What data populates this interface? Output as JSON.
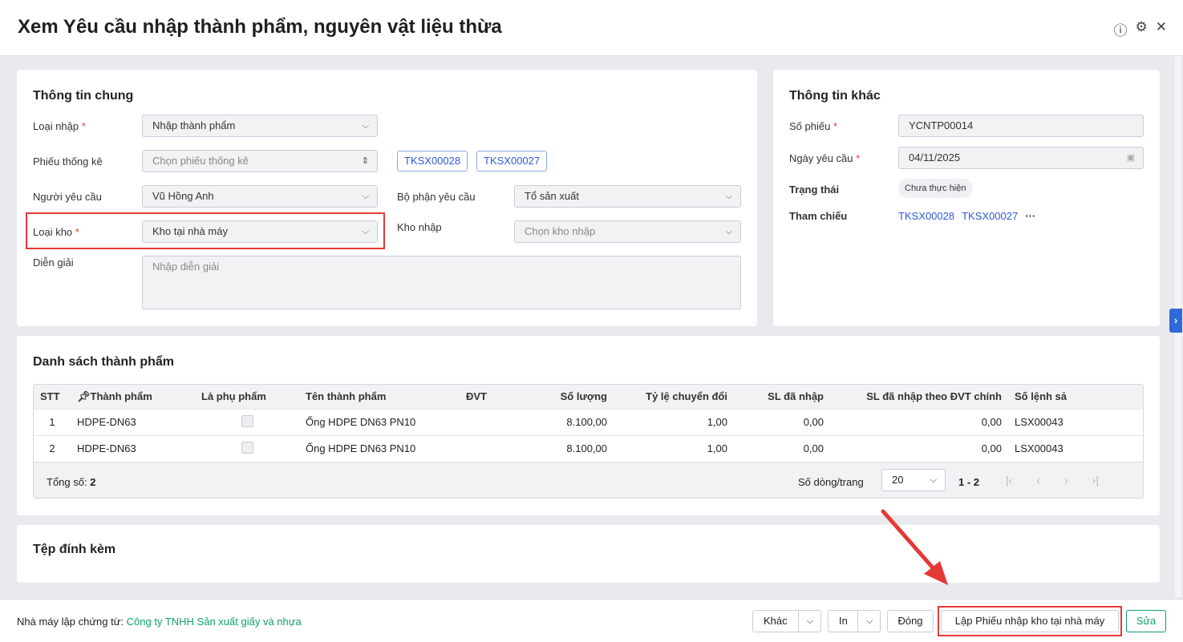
{
  "title": "Xem Yêu cầu nhập thành phẩm, nguyên vật liệu thừa",
  "header_icons": [
    "help-icon",
    "gear-icon",
    "close-icon"
  ],
  "general": {
    "title": "Thông tin chung",
    "loai_nhap_label": "Loại nhập",
    "loai_nhap_value": "Nhập thành phẩm",
    "phieu_tk_label": "Phiếu thống kê",
    "phieu_tk_placeholder": "Chọn phiếu thống kê",
    "tags": [
      "TKSX00028",
      "TKSX00027"
    ],
    "nguoi_yc_label": "Người yêu cầu",
    "nguoi_yc_value": "Vũ Hồng Anh",
    "bo_phan_label": "Bộ phận yêu cầu",
    "bo_phan_value": "Tổ sản xuất",
    "loai_kho_label": "Loại kho",
    "loai_kho_value": "Kho tại nhà máy",
    "kho_nhap_label": "Kho nhập",
    "kho_nhap_placeholder": "Chọn kho nhập",
    "dien_giai_label": "Diễn giải",
    "dien_giai_placeholder": "Nhập diễn giải",
    "required": "*"
  },
  "other": {
    "title": "Thông tin khác",
    "so_phieu_label": "Số phiếu",
    "so_phieu_value": "YCNTP00014",
    "ngay_label": "Ngày yêu cầu",
    "ngay_value": "04/11/2025",
    "trang_thai_label": "Trạng thái",
    "trang_thai_value": "Chưa thực hiện",
    "tham_chieu_label": "Tham chiếu",
    "tham_chieu": [
      "TKSX00028",
      "TKSX00027"
    ],
    "more": "···"
  },
  "products": {
    "title": "Danh sách thành phẩm",
    "columns": [
      "STT",
      "Thành phẩm",
      "Là phụ phẩm",
      "Tên thành phẩm",
      "ĐVT",
      "Số lượng",
      "Tỷ lệ chuyển đổi",
      "SL đã nhập",
      "SL đã nhập theo ĐVT chính",
      "Số lệnh sả"
    ],
    "rows": [
      {
        "stt": "1",
        "code": "HDPE-DN63",
        "name": "Ống HDPE DN63 PN10",
        "dvt": "",
        "qty": "8.100,00",
        "ratio": "1,00",
        "imported": "0,00",
        "imported_main": "0,00",
        "order": "LSX00043"
      },
      {
        "stt": "2",
        "code": "HDPE-DN63",
        "name": "Ống HDPE DN63 PN10",
        "dvt": "",
        "qty": "8.100,00",
        "ratio": "1,00",
        "imported": "0,00",
        "imported_main": "0,00",
        "order": "LSX00043"
      }
    ],
    "total_label": "Tổng số:",
    "total": "2",
    "page_size_label": "Số dòng/trang",
    "page_size": "20",
    "range": "1 - 2"
  },
  "attachments": {
    "title": "Tệp đính kèm"
  },
  "footer": {
    "factory_label": "Nhà máy lập chứng từ:",
    "factory_value": "Công ty TNHH Sản xuất giấy và nhựa",
    "other_btn": "Khác",
    "print_btn": "In",
    "close_btn": "Đóng",
    "create_btn": "Lập Phiếu nhập kho tại nhà máy",
    "edit_btn": "Sửa"
  },
  "colors": {
    "accent": "#2d5bd7",
    "green": "#0e9f6e",
    "highlight": "#e53935"
  }
}
